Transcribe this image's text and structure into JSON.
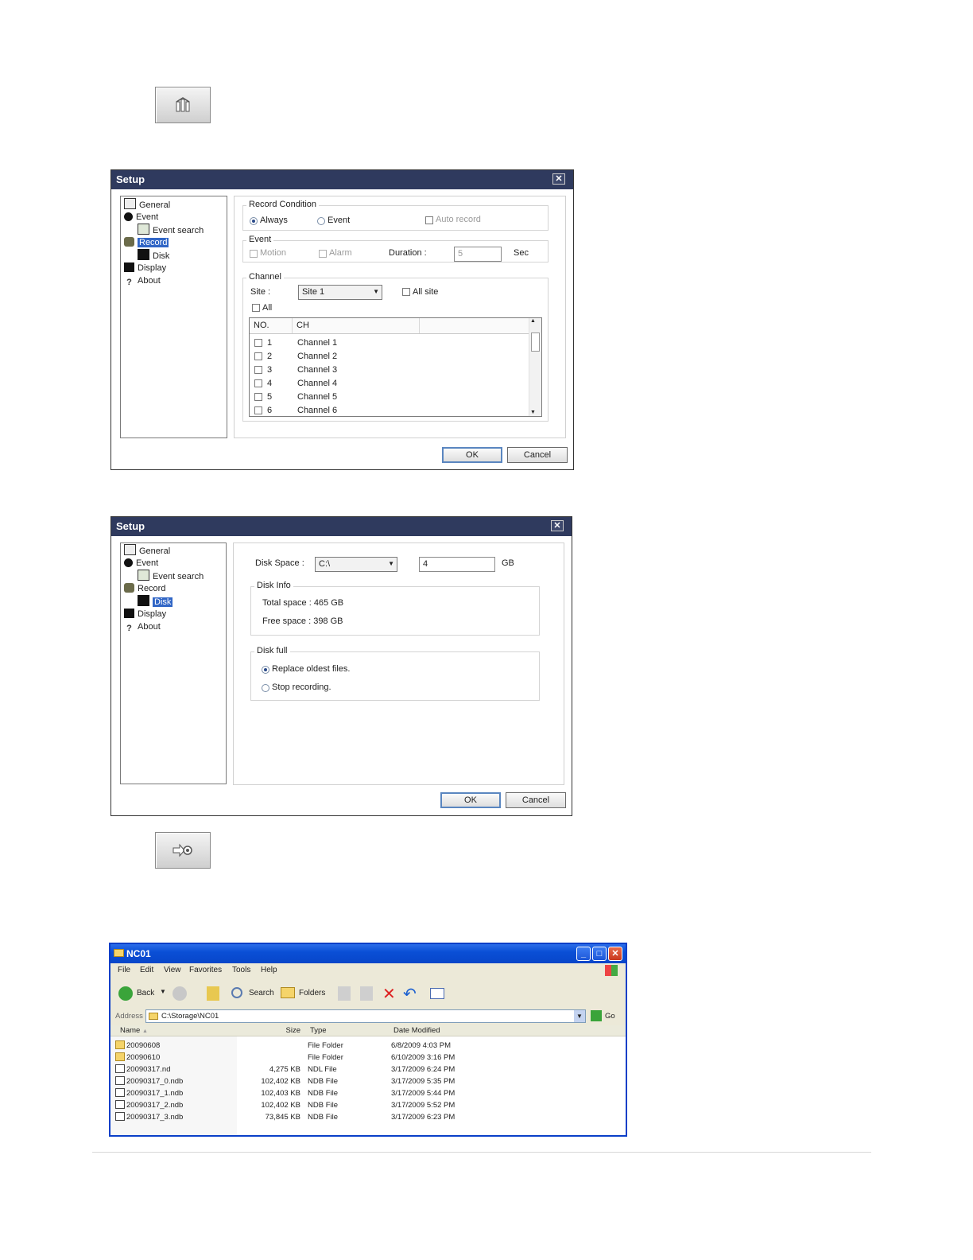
{
  "setup_button": {
    "icon": "tools-icon"
  },
  "connect_button": {
    "icon": "storage-connect-icon"
  },
  "setup_record": {
    "title": "Setup",
    "close": "✕",
    "tree": [
      "General",
      "Event",
      "Event search",
      "Record",
      "Disk",
      "Display",
      "About"
    ],
    "selected": "Record",
    "record_condition": {
      "label": "Record Condition",
      "always": "Always",
      "event": "Event",
      "auto_record": "Auto record",
      "selected": "Always"
    },
    "event": {
      "label": "Event",
      "motion": "Motion",
      "alarm": "Alarm",
      "duration_label": "Duration :",
      "duration_value": "5",
      "unit": "Sec"
    },
    "channel": {
      "label": "Channel",
      "site_label": "Site :",
      "site_value": "Site 1",
      "all_site": "All site",
      "all": "All",
      "col_no": "NO.",
      "col_ch": "CH",
      "rows": [
        {
          "no": "1",
          "ch": "Channel 1"
        },
        {
          "no": "2",
          "ch": "Channel 2"
        },
        {
          "no": "3",
          "ch": "Channel 3"
        },
        {
          "no": "4",
          "ch": "Channel 4"
        },
        {
          "no": "5",
          "ch": "Channel 5"
        },
        {
          "no": "6",
          "ch": "Channel 6"
        }
      ]
    },
    "ok": "OK",
    "cancel": "Cancel"
  },
  "setup_disk": {
    "title": "Setup",
    "close": "✕",
    "tree": [
      "General",
      "Event",
      "Event search",
      "Record",
      "Disk",
      "Display",
      "About"
    ],
    "selected": "Disk",
    "disk_space_label": "Disk Space :",
    "drive": "C:\\",
    "size_value": "4",
    "size_unit": "GB",
    "disk_info": {
      "label": "Disk Info",
      "total": "Total space : 465 GB",
      "free": "Free space : 398 GB"
    },
    "disk_full": {
      "label": "Disk full",
      "replace": "Replace oldest files.",
      "stop": "Stop recording.",
      "selected": "Replace oldest files."
    },
    "ok": "OK",
    "cancel": "Cancel"
  },
  "explorer": {
    "title": "NC01",
    "menu": [
      "File",
      "Edit",
      "View",
      "Favorites",
      "Tools",
      "Help"
    ],
    "toolbar": {
      "back": "Back",
      "search": "Search",
      "folders": "Folders"
    },
    "address_label": "Address",
    "address_value": "C:\\Storage\\NC01",
    "go": "Go",
    "columns": [
      "Name",
      "Size",
      "Type",
      "Date Modified"
    ],
    "files": [
      {
        "name": "20090608",
        "size": "",
        "type": "File Folder",
        "date": "6/8/2009 4:03 PM",
        "kind": "folder"
      },
      {
        "name": "20090610",
        "size": "",
        "type": "File Folder",
        "date": "6/10/2009 3:16 PM",
        "kind": "folder"
      },
      {
        "name": "20090317.nd",
        "size": "4,275 KB",
        "type": "NDL File",
        "date": "3/17/2009 6:24 PM",
        "kind": "file"
      },
      {
        "name": "20090317_0.ndb",
        "size": "102,402 KB",
        "type": "NDB File",
        "date": "3/17/2009 5:35 PM",
        "kind": "file"
      },
      {
        "name": "20090317_1.ndb",
        "size": "102,403 KB",
        "type": "NDB File",
        "date": "3/17/2009 5:44 PM",
        "kind": "file"
      },
      {
        "name": "20090317_2.ndb",
        "size": "102,402 KB",
        "type": "NDB File",
        "date": "3/17/2009 5:52 PM",
        "kind": "file"
      },
      {
        "name": "20090317_3.ndb",
        "size": "73,845 KB",
        "type": "NDB File",
        "date": "3/17/2009 6:23 PM",
        "kind": "file"
      }
    ]
  }
}
